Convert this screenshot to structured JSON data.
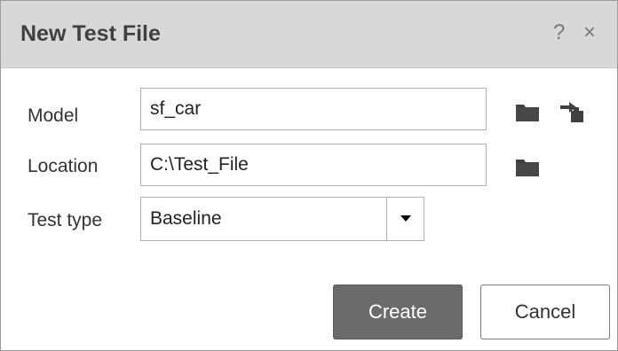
{
  "dialog": {
    "title": "New Test File",
    "help_label": "?",
    "close_label": "×"
  },
  "form": {
    "model": {
      "label": "Model",
      "value": "sf_car"
    },
    "location": {
      "label": "Location",
      "value": "C:\\Test_File"
    },
    "test_type": {
      "label": "Test type",
      "value": "Baseline"
    }
  },
  "icons": {
    "model_browse": "folder-icon",
    "model_current": "use-current-model-icon",
    "location_browse": "folder-icon",
    "dropdown": "caret-down-icon"
  },
  "buttons": {
    "create_label": "Create",
    "cancel_label": "Cancel"
  },
  "colors": {
    "titlebar": "#d8d8d8",
    "primary_button": "#6b6b6b",
    "icon": "#404040"
  }
}
